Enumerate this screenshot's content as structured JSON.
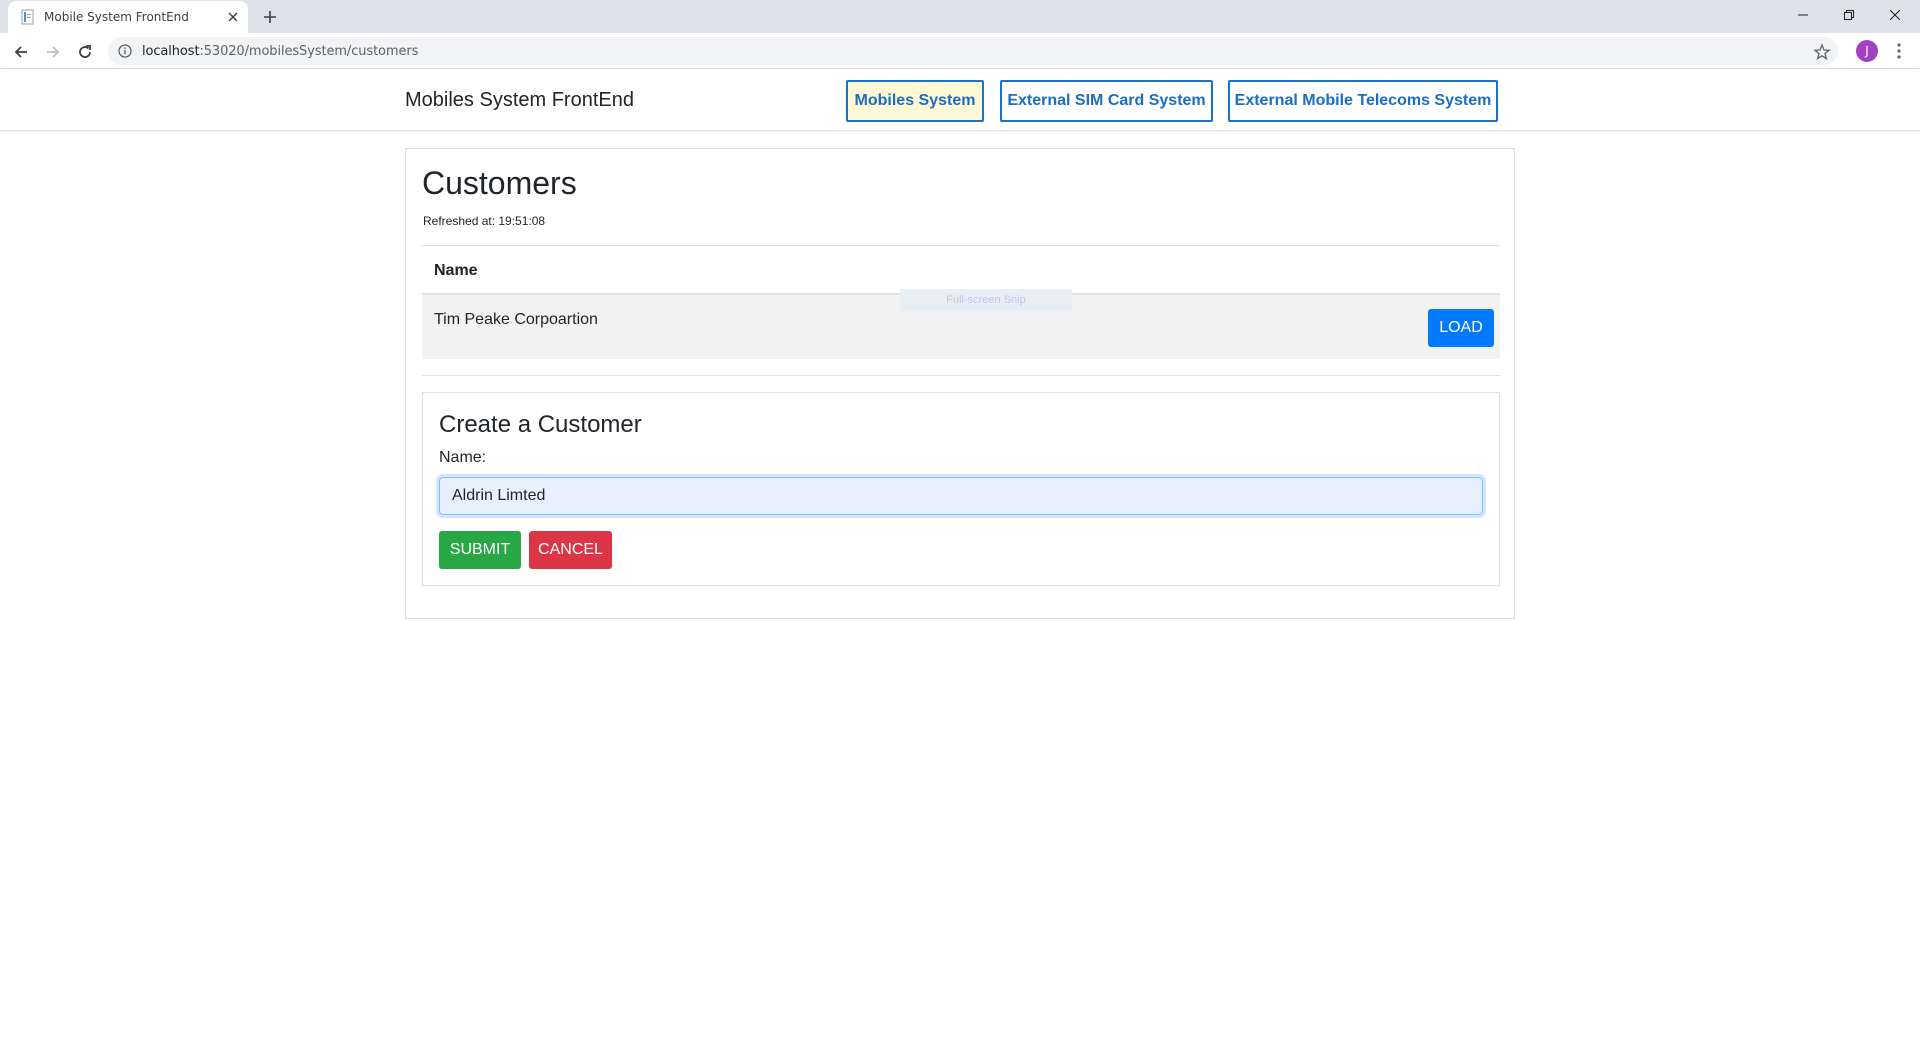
{
  "browser": {
    "tab_title": "Mobile System FrontEnd",
    "url_host": "localhost",
    "url_path": ":53020/mobilesSystem/customers",
    "avatar_letter": "J"
  },
  "navbar": {
    "brand": "Mobiles System FrontEnd",
    "links": [
      {
        "label": "Mobiles System",
        "active": true
      },
      {
        "label": "External SIM Card System",
        "active": false
      },
      {
        "label": "External Mobile Telecoms System",
        "active": false
      }
    ]
  },
  "customers": {
    "title": "Customers",
    "refreshed": "Refreshed at: 19:51:08",
    "column_name": "Name",
    "rows": [
      {
        "name": "Tim Peake Corpoartion",
        "action": "LOAD"
      }
    ],
    "overlay_text": "Full-screen Snip"
  },
  "create": {
    "title": "Create a Customer",
    "name_label": "Name:",
    "name_value": "Aldrin Limted",
    "submit_label": "SUBMIT",
    "cancel_label": "CANCEL"
  },
  "colors": {
    "primary": "#007bff",
    "success": "#28a745",
    "danger": "#dc3545",
    "nav_border": "#1a73c8",
    "active_nav_bg": "#fff8d6"
  }
}
